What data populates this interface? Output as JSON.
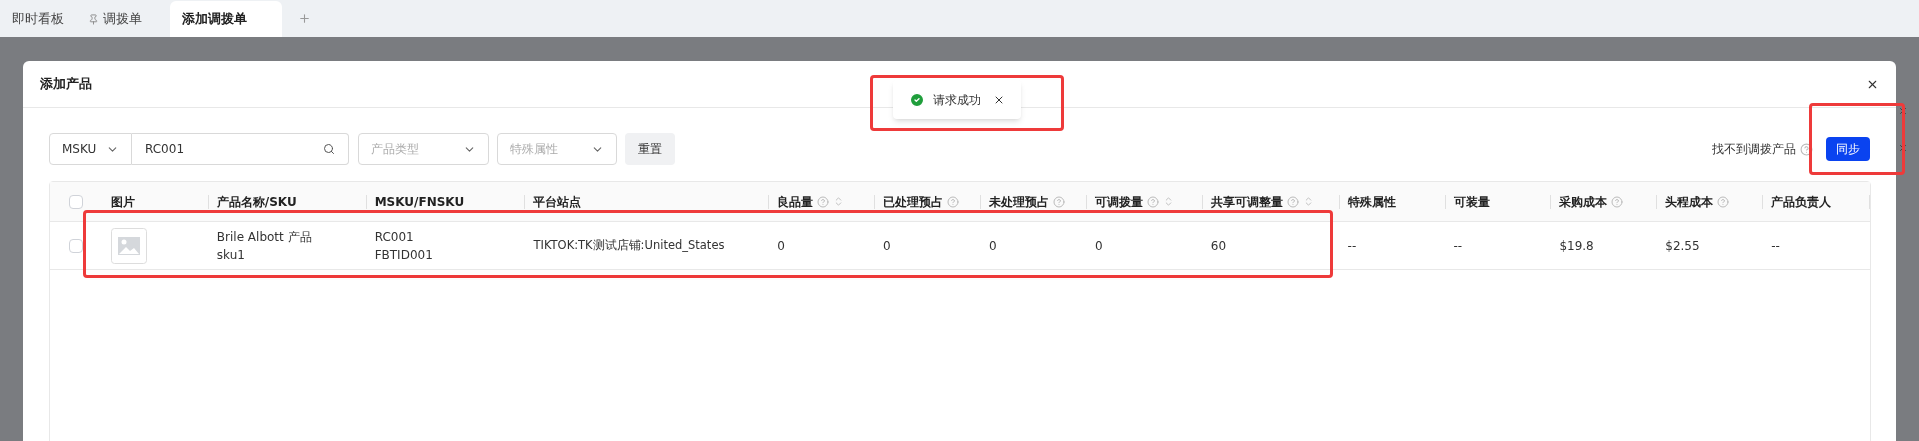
{
  "tabs": [
    {
      "label": "即时看板",
      "selected": false,
      "pinned": false
    },
    {
      "label": "调拨单",
      "selected": false,
      "pinned": true
    },
    {
      "label": "添加调拨单",
      "selected": true,
      "pinned": false
    }
  ],
  "modal": {
    "title": "添加产品"
  },
  "toast": {
    "message": "请求成功"
  },
  "filters": {
    "search_type": "MSKU",
    "search_value": "RC001",
    "product_type_placeholder": "产品类型",
    "special_attr_placeholder": "特殊属性",
    "reset_button": "重置",
    "not_found_text": "找不到调拨产品",
    "sync_button": "同步"
  },
  "table": {
    "header_checked": false,
    "columns": [
      {
        "label": "图片",
        "help": false,
        "sortable": false
      },
      {
        "label": "产品名称/SKU",
        "help": false,
        "sortable": false
      },
      {
        "label": "MSKU/FNSKU",
        "help": false,
        "sortable": false
      },
      {
        "label": "平台站点",
        "help": false,
        "sortable": false
      },
      {
        "label": "良品量",
        "help": true,
        "sortable": true
      },
      {
        "label": "已处理预占",
        "help": true,
        "sortable": false
      },
      {
        "label": "未处理预占",
        "help": true,
        "sortable": false
      },
      {
        "label": "可调拨量",
        "help": true,
        "sortable": true
      },
      {
        "label": "共享可调整量",
        "help": true,
        "sortable": true
      },
      {
        "label": "特殊属性",
        "help": false,
        "sortable": false
      },
      {
        "label": "可装量",
        "help": false,
        "sortable": false
      },
      {
        "label": "采购成本",
        "help": true,
        "sortable": false
      },
      {
        "label": "头程成本",
        "help": true,
        "sortable": false
      },
      {
        "label": "产品负责人",
        "help": false,
        "sortable": false
      }
    ],
    "rows": [
      {
        "checked": false,
        "product_name": "Brile Albott 产品",
        "sku": "sku1",
        "msku": "RC001",
        "fnsku": "FBTID001",
        "site": "TIKTOK:TK测试店铺:United_States",
        "values": [
          "0",
          "0",
          "0",
          "0",
          "60",
          "--",
          "--",
          "$19.8",
          "$2.55",
          "--"
        ]
      }
    ]
  }
}
